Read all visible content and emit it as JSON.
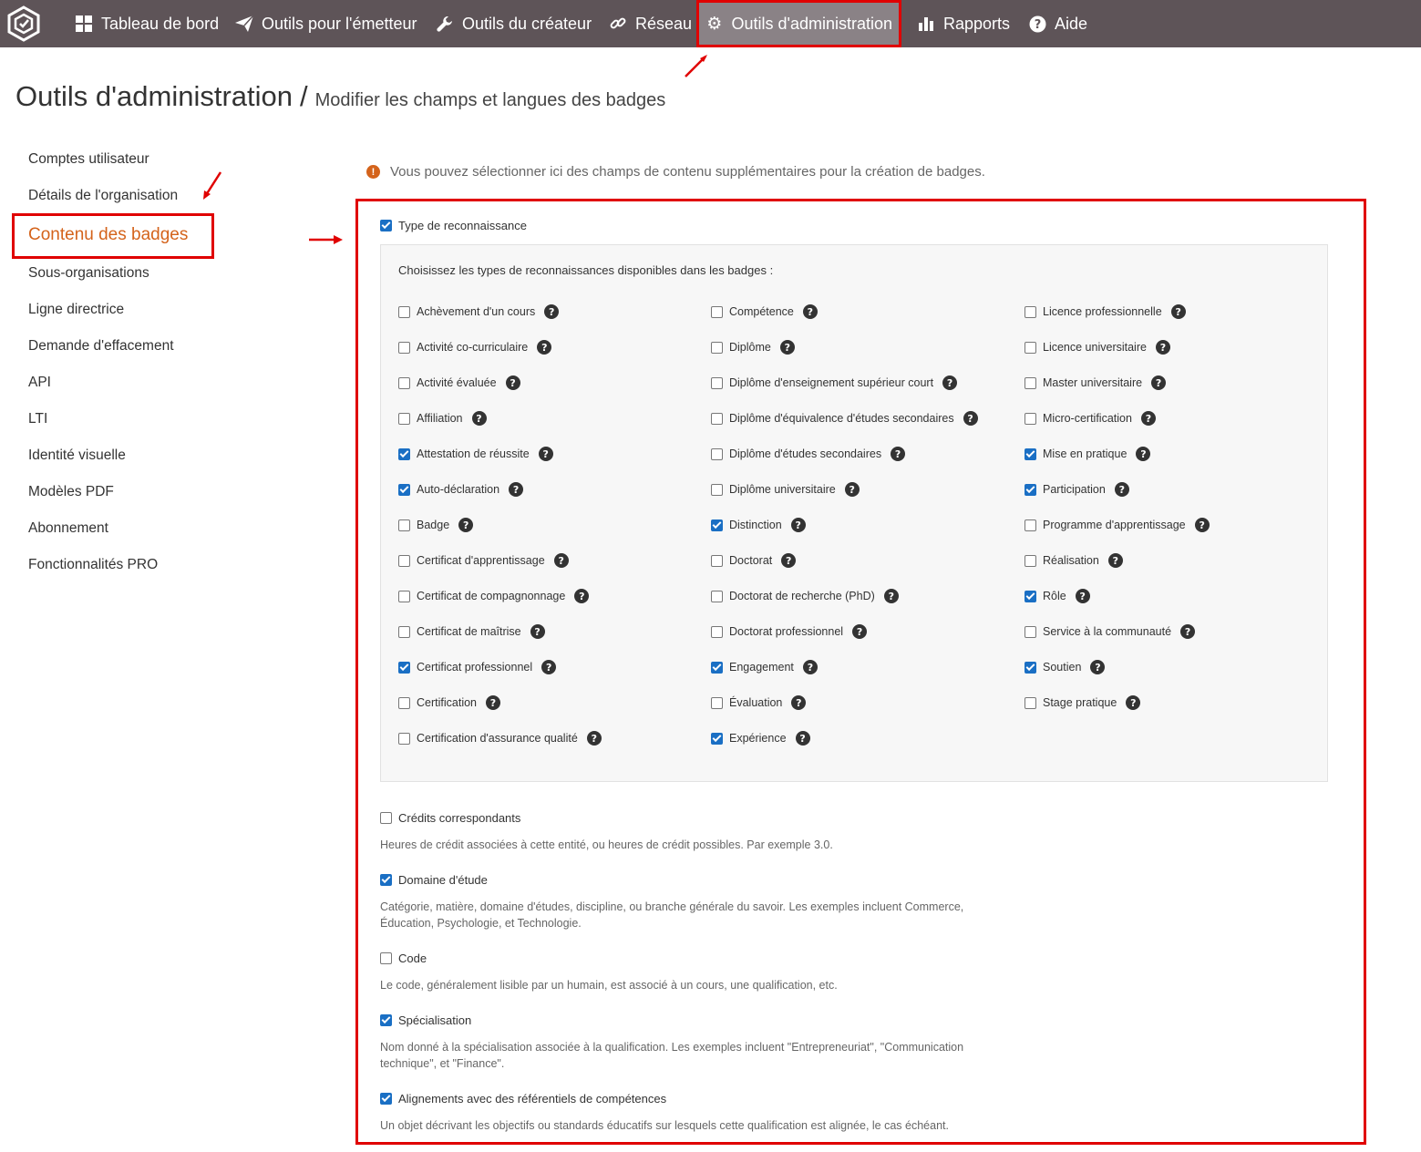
{
  "nav": {
    "items": [
      {
        "label": "Tableau de bord",
        "icon": "dashboard-icon"
      },
      {
        "label": "Outils pour l'émetteur",
        "icon": "paper-plane-icon"
      },
      {
        "label": "Outils du créateur",
        "icon": "wrench-icon"
      },
      {
        "label": "Réseau",
        "icon": "link-icon"
      },
      {
        "label": "Outils d'administration",
        "icon": "gear-icon",
        "active": true
      },
      {
        "label": "Rapports",
        "icon": "bar-chart-icon"
      },
      {
        "label": "Aide",
        "icon": "question-circle-icon"
      }
    ]
  },
  "header": {
    "title": "Outils d'administration",
    "separator": "/",
    "subtitle": "Modifier les champs et langues des badges"
  },
  "sidebar": {
    "items": [
      {
        "label": "Comptes utilisateur"
      },
      {
        "label": "Détails de l'organisation"
      },
      {
        "label": "Contenu des badges",
        "active": true
      },
      {
        "label": "Sous-organisations"
      },
      {
        "label": "Ligne directrice"
      },
      {
        "label": "Demande d'effacement"
      },
      {
        "label": "API"
      },
      {
        "label": "LTI"
      },
      {
        "label": "Identité visuelle"
      },
      {
        "label": "Modèles PDF"
      },
      {
        "label": "Abonnement"
      },
      {
        "label": "Fonctionnalités PRO"
      }
    ]
  },
  "info": {
    "text": "Vous pouvez sélectionner ici des champs de contenu supplémentaires pour la création de badges."
  },
  "recognition": {
    "label": "Type de reconnaissance",
    "checked": true,
    "intro": "Choisissez les types de reconnaissances disponibles dans les badges :",
    "columns": [
      [
        {
          "label": "Achèvement d'un cours",
          "checked": false
        },
        {
          "label": "Activité co-curriculaire",
          "checked": false
        },
        {
          "label": "Activité évaluée",
          "checked": false
        },
        {
          "label": "Affiliation",
          "checked": false
        },
        {
          "label": "Attestation de réussite",
          "checked": true
        },
        {
          "label": "Auto-déclaration",
          "checked": true
        },
        {
          "label": "Badge",
          "checked": false
        },
        {
          "label": "Certificat d'apprentissage",
          "checked": false
        },
        {
          "label": "Certificat de compagnonnage",
          "checked": false
        },
        {
          "label": "Certificat de maîtrise",
          "checked": false
        },
        {
          "label": "Certificat professionnel",
          "checked": true
        },
        {
          "label": "Certification",
          "checked": false
        },
        {
          "label": "Certification d'assurance qualité",
          "checked": false
        }
      ],
      [
        {
          "label": "Compétence",
          "checked": false
        },
        {
          "label": "Diplôme",
          "checked": false
        },
        {
          "label": "Diplôme d'enseignement supérieur court",
          "checked": false
        },
        {
          "label": "Diplôme d'équivalence d'études secondaires",
          "checked": false
        },
        {
          "label": "Diplôme d'études secondaires",
          "checked": false
        },
        {
          "label": "Diplôme universitaire",
          "checked": false
        },
        {
          "label": "Distinction",
          "checked": true
        },
        {
          "label": "Doctorat",
          "checked": false
        },
        {
          "label": "Doctorat de recherche (PhD)",
          "checked": false
        },
        {
          "label": "Doctorat professionnel",
          "checked": false
        },
        {
          "label": "Engagement",
          "checked": true
        },
        {
          "label": "Évaluation",
          "checked": false
        },
        {
          "label": "Expérience",
          "checked": true
        }
      ],
      [
        {
          "label": "Licence professionnelle",
          "checked": false
        },
        {
          "label": "Licence universitaire",
          "checked": false
        },
        {
          "label": "Master universitaire",
          "checked": false
        },
        {
          "label": "Micro-certification",
          "checked": false
        },
        {
          "label": "Mise en pratique",
          "checked": true
        },
        {
          "label": "Participation",
          "checked": true
        },
        {
          "label": "Programme d'apprentissage",
          "checked": false
        },
        {
          "label": "Réalisation",
          "checked": false
        },
        {
          "label": "Rôle",
          "checked": true
        },
        {
          "label": "Service à la communauté",
          "checked": false
        },
        {
          "label": "Soutien",
          "checked": true
        },
        {
          "label": "Stage pratique",
          "checked": false
        }
      ]
    ]
  },
  "fields": [
    {
      "label": "Crédits correspondants",
      "checked": false,
      "desc": "Heures de crédit associées à cette entité, ou heures de crédit possibles. Par exemple 3.0."
    },
    {
      "label": "Domaine d'étude",
      "checked": true,
      "desc": "Catégorie, matière, domaine d'études, discipline, ou branche générale du savoir. Les exemples incluent Commerce, Éducation, Psychologie, et Technologie."
    },
    {
      "label": "Code",
      "checked": false,
      "desc": "Le code, généralement lisible par un humain, est associé à un cours, une qualification, etc."
    },
    {
      "label": "Spécialisation",
      "checked": true,
      "desc": "Nom donné à la spécialisation associée à la qualification. Les exemples incluent \"Entrepreneuriat\", \"Communication technique\", et \"Finance\"."
    },
    {
      "label": "Alignements avec des référentiels de compétences",
      "checked": true,
      "desc": "Un objet décrivant les objectifs ou standards éducatifs sur lesquels cette qualification est alignée, le cas échéant."
    }
  ],
  "colors": {
    "topbar": "#5e5458",
    "accent": "#d4631b",
    "annotation": "#e00000",
    "checkbox": "#1a6fc4"
  }
}
